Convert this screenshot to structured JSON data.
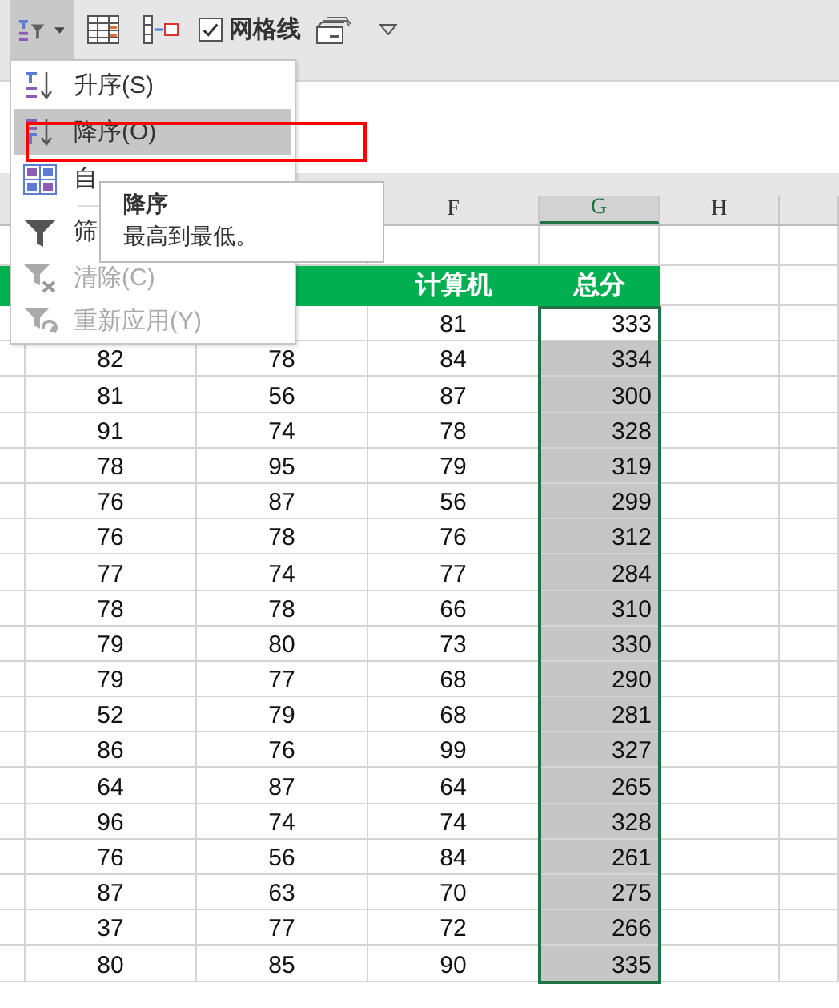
{
  "toolbar": {
    "sort_button": {
      "pressed": true
    },
    "gridlines": {
      "label": "网格线",
      "checked": true
    }
  },
  "sort_menu": {
    "items": [
      {
        "kind": "asc",
        "label": "升序(S)",
        "selected": false,
        "disabled": false
      },
      {
        "kind": "desc",
        "label": "降序(O)",
        "selected": true,
        "disabled": false
      },
      {
        "kind": "custom",
        "label": "自",
        "selected": false,
        "disabled": false
      },
      {
        "kind": "filter",
        "label": "筛",
        "selected": false,
        "disabled": false
      },
      {
        "kind": "clear",
        "label": "清除(C)",
        "selected": false,
        "disabled": true
      },
      {
        "kind": "reapply",
        "label": "重新应用(Y)",
        "selected": false,
        "disabled": true
      }
    ]
  },
  "tooltip": {
    "title": "降序",
    "text": "最高到最低。"
  },
  "sheet": {
    "column_headers": [
      {
        "label": "F",
        "selected": false
      },
      {
        "label": "G",
        "selected": true
      },
      {
        "label": "H",
        "selected": false
      }
    ],
    "header_row": [
      "计算机",
      "总分"
    ],
    "rows": [
      {
        "cells": [
          "",
          "",
          "81",
          "333"
        ],
        "highlighted": false
      },
      {
        "cells": [
          "82",
          "78",
          "84",
          "334"
        ],
        "highlighted": true
      },
      {
        "cells": [
          "81",
          "56",
          "87",
          "300"
        ],
        "highlighted": true
      },
      {
        "cells": [
          "91",
          "74",
          "78",
          "328"
        ],
        "highlighted": true
      },
      {
        "cells": [
          "78",
          "95",
          "79",
          "319"
        ],
        "highlighted": true
      },
      {
        "cells": [
          "76",
          "87",
          "56",
          "299"
        ],
        "highlighted": true
      },
      {
        "cells": [
          "76",
          "78",
          "76",
          "312"
        ],
        "highlighted": true
      },
      {
        "cells": [
          "77",
          "74",
          "77",
          "284"
        ],
        "highlighted": true
      },
      {
        "cells": [
          "78",
          "78",
          "66",
          "310"
        ],
        "highlighted": true
      },
      {
        "cells": [
          "79",
          "80",
          "73",
          "330"
        ],
        "highlighted": true
      },
      {
        "cells": [
          "79",
          "77",
          "68",
          "290"
        ],
        "highlighted": true
      },
      {
        "cells": [
          "52",
          "79",
          "68",
          "281"
        ],
        "highlighted": true
      },
      {
        "cells": [
          "86",
          "76",
          "99",
          "327"
        ],
        "highlighted": true
      },
      {
        "cells": [
          "64",
          "87",
          "64",
          "265"
        ],
        "highlighted": true
      },
      {
        "cells": [
          "96",
          "74",
          "74",
          "328"
        ],
        "highlighted": true
      },
      {
        "cells": [
          "76",
          "56",
          "84",
          "261"
        ],
        "highlighted": true
      },
      {
        "cells": [
          "87",
          "63",
          "70",
          "275"
        ],
        "highlighted": true
      },
      {
        "cells": [
          "37",
          "77",
          "72",
          "266"
        ],
        "highlighted": true
      },
      {
        "cells": [
          "80",
          "85",
          "90",
          "335"
        ],
        "highlighted": true
      }
    ]
  }
}
